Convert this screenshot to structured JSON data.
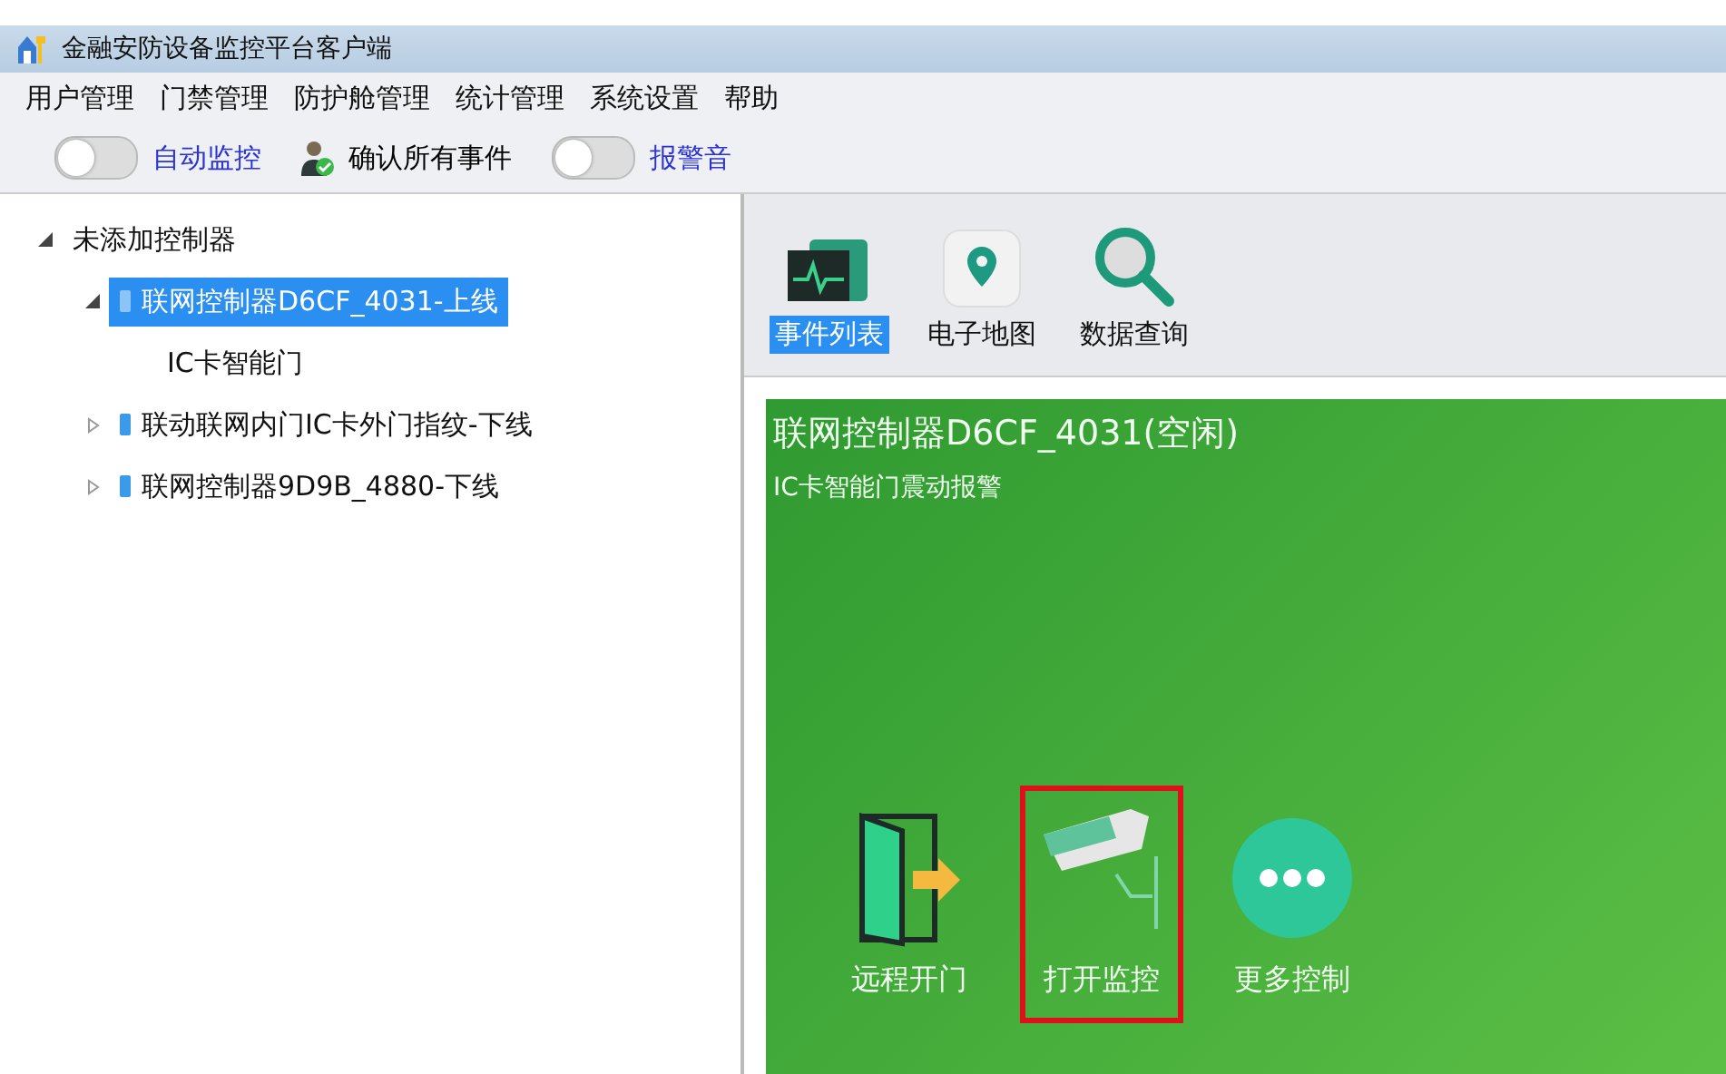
{
  "window": {
    "title": "金融安防设备监控平台客户端"
  },
  "menu": [
    "用户管理",
    "门禁管理",
    "防护舱管理",
    "统计管理",
    "系统设置",
    "帮助"
  ],
  "toolbar": [
    {
      "kind": "toggle",
      "label": "自动监控",
      "on": false
    },
    {
      "kind": "button",
      "label": "确认所有事件"
    },
    {
      "kind": "toggle",
      "label": "报警音",
      "on": false
    }
  ],
  "tree": [
    {
      "label": "未添加控制器",
      "expanded": true,
      "selected": false,
      "children": [
        {
          "label": "联网控制器D6CF_4031-上线",
          "expanded": true,
          "selected": true,
          "children": [
            {
              "label": "IC卡智能门",
              "selected": false
            }
          ]
        },
        {
          "label": "联动联网内门IC卡外门指纹-下线",
          "expanded": false,
          "selected": false
        },
        {
          "label": "联网控制器9D9B_4880-下线",
          "expanded": false,
          "selected": false
        }
      ]
    }
  ],
  "tabs": [
    {
      "kind": "monitor",
      "label": "事件列表",
      "selected": true
    },
    {
      "kind": "map",
      "label": "电子地图",
      "selected": false
    },
    {
      "kind": "search",
      "label": "数据查询",
      "selected": false
    }
  ],
  "panel": {
    "title": "联网控制器D6CF_4031(空闲)",
    "subtitle": "IC卡智能门震动报警",
    "actions": [
      {
        "kind": "door",
        "label": "远程开门",
        "highlighted": false
      },
      {
        "kind": "camera",
        "label": "打开监控",
        "highlighted": true
      },
      {
        "kind": "more",
        "label": "更多控制",
        "highlighted": false
      }
    ]
  }
}
